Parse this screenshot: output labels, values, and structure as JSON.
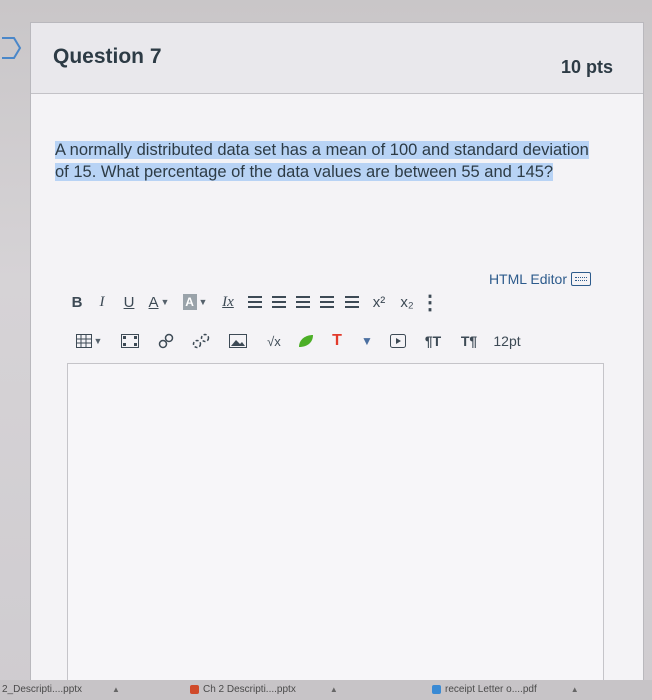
{
  "question": {
    "title": "Question 7",
    "points": "10 pts",
    "text": "A normally distributed data set has a mean of 100 and standard deviation of 15. What percentage of the data values are between 55 and 145?"
  },
  "editor": {
    "html_editor_label": "HTML Editor",
    "font_size": "12pt",
    "toolbar_row1": [
      "bold",
      "italic",
      "underline",
      "font-color",
      "background-color",
      "clear-formatting",
      "align-left",
      "align-center",
      "align-right",
      "indent",
      "outdent",
      "superscript",
      "subscript",
      "more"
    ],
    "toolbar_row2": [
      "table",
      "media",
      "link",
      "unlink",
      "image",
      "equation",
      "lti-apps",
      "text-tool",
      "dropdown",
      "embed",
      "ltr",
      "rtl",
      "font-size"
    ]
  },
  "toolbar_glyphs": {
    "bold": "B",
    "italic": "I",
    "underline": "U",
    "font_color": "A",
    "background_color": "A",
    "clear_formatting": "Ix",
    "superscript": "x²",
    "subscript": "x₂",
    "more": "⋮",
    "equation": "√x",
    "text_tool": "T",
    "dropdown": "▼",
    "ltr": "¶T",
    "rtl": "T¶"
  },
  "taskbar": {
    "items": [
      {
        "label": "2_Descripti....pptx"
      },
      {
        "label": "Ch 2 Descripti....pptx"
      },
      {
        "label": "receipt Letter o....pdf"
      }
    ]
  },
  "colors": {
    "highlight": "#b8d3f5",
    "link": "#2d5b8c",
    "text": "#2d3b45",
    "leaf_green": "#4caf27",
    "text_tool_red": "#e23a2b",
    "dropdown_blue": "#4a6fa0"
  }
}
